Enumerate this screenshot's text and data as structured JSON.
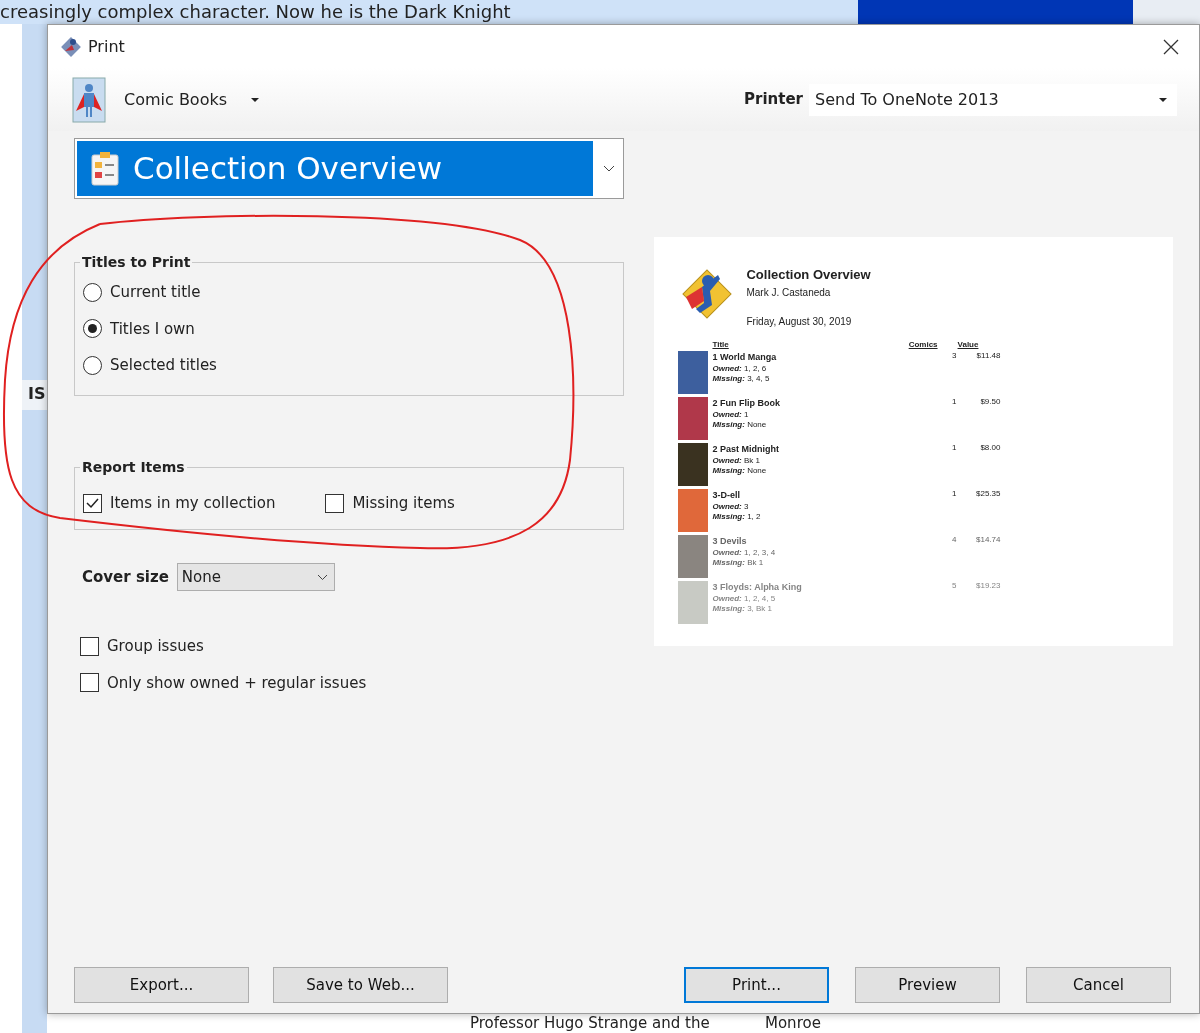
{
  "background": {
    "top_text": "creasingly complex character. Now he is the Dark Knight",
    "side_text": "IS",
    "bottom_texts": [
      "Professor Hugo Strange and the",
      "Monroe"
    ]
  },
  "window": {
    "title": "Print"
  },
  "collection": {
    "label": "Comic Books"
  },
  "printer": {
    "label": "Printer",
    "value": "Send To OneNote 2013"
  },
  "report": {
    "value": "Collection Overview"
  },
  "titles_to_print": {
    "legend": "Titles to Print",
    "options": [
      {
        "label": "Current title",
        "selected": false
      },
      {
        "label": "Titles I own",
        "selected": true
      },
      {
        "label": "Selected titles",
        "selected": false
      }
    ]
  },
  "report_items": {
    "legend": "Report Items",
    "options": [
      {
        "label": "Items in my collection",
        "checked": true
      },
      {
        "label": "Missing items",
        "checked": false
      }
    ]
  },
  "cover_size": {
    "label": "Cover size",
    "value": "None"
  },
  "options": [
    {
      "label": "Group issues",
      "checked": false
    },
    {
      "label": "Only show owned + regular issues",
      "checked": false
    }
  ],
  "preview": {
    "title": "Collection Overview",
    "owner": "Mark J. Castaneda",
    "date": "Friday, August 30, 2019",
    "columns": [
      "Title",
      "Comics",
      "Value"
    ],
    "rows": [
      {
        "title": "1 World Manga",
        "owned": "**Owned:** 1, 2, 6",
        "missing": "**Missing:** 3, 4, 5",
        "comics": "3",
        "value": "$11.48",
        "color": "#3d5f9e",
        "kind": "normal"
      },
      {
        "title": "2 Fun Flip Book",
        "owned": "**Owned:** 1",
        "missing": "**Missing:** None",
        "comics": "1",
        "value": "$9.50",
        "color": "#b0384a",
        "kind": "normal"
      },
      {
        "title": "2 Past Midnight",
        "owned": "**Owned:** Bk 1",
        "missing": "**Missing:** None",
        "comics": "1",
        "value": "$8.00",
        "color": "#3a3220",
        "kind": "normal"
      },
      {
        "title": "3-D-ell",
        "owned": "**Owned:** 3",
        "missing": "**Missing:** 1, 2",
        "comics": "1",
        "value": "$25.35",
        "color": "#e0683a",
        "kind": "normal"
      },
      {
        "title": "3 Devils",
        "owned": "**Owned:** 1, 2, 3, 4",
        "missing": "**Missing:** Bk 1",
        "comics": "4",
        "value": "$14.74",
        "color": "#8a8580",
        "kind": "faded"
      },
      {
        "title": "3 Floyds: Alpha King",
        "owned": "**Owned:** 1, 2, 4, 5",
        "missing": "**Missing:** 3, Bk 1",
        "comics": "5",
        "value": "$19.23",
        "color": "#c8cac4",
        "kind": "faint"
      }
    ]
  },
  "left_buttons": [
    {
      "label": "Export...",
      "default": false
    },
    {
      "label": "Save to Web...",
      "default": false
    }
  ],
  "right_buttons": [
    {
      "label": "Print...",
      "default": true
    },
    {
      "label": "Preview",
      "default": false
    },
    {
      "label": "Cancel",
      "default": false
    }
  ]
}
